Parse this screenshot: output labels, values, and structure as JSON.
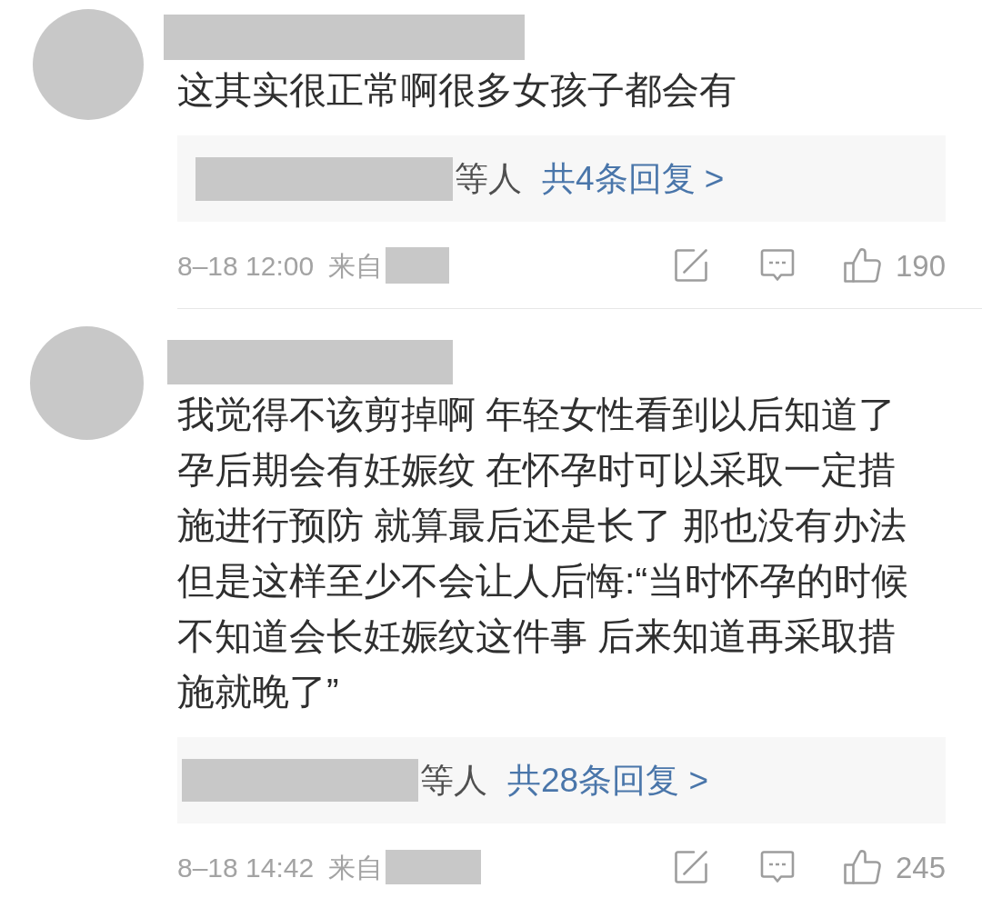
{
  "comments": [
    {
      "text": "这其实很正常啊很多女孩子都会有",
      "replies": {
        "suffix": "等人",
        "link": "共4条回复 >"
      },
      "time": "8–18 12:00",
      "source_label": "来自",
      "likes": "190"
    },
    {
      "text": "我觉得不该剪掉啊 年轻女性看到以后知道了孕后期会有妊娠纹 在怀孕时可以采取一定措施进行预防 就算最后还是长了 那也没有办法但是这样至少不会让人后悔:“当时怀孕的时候不知道会长妊娠纹这件事 后来知道再采取措施就晚了”",
      "replies": {
        "suffix": "等人",
        "link": "共28条回复 >"
      },
      "time": "8–18 14:42",
      "source_label": "来自",
      "likes": "245"
    }
  ]
}
